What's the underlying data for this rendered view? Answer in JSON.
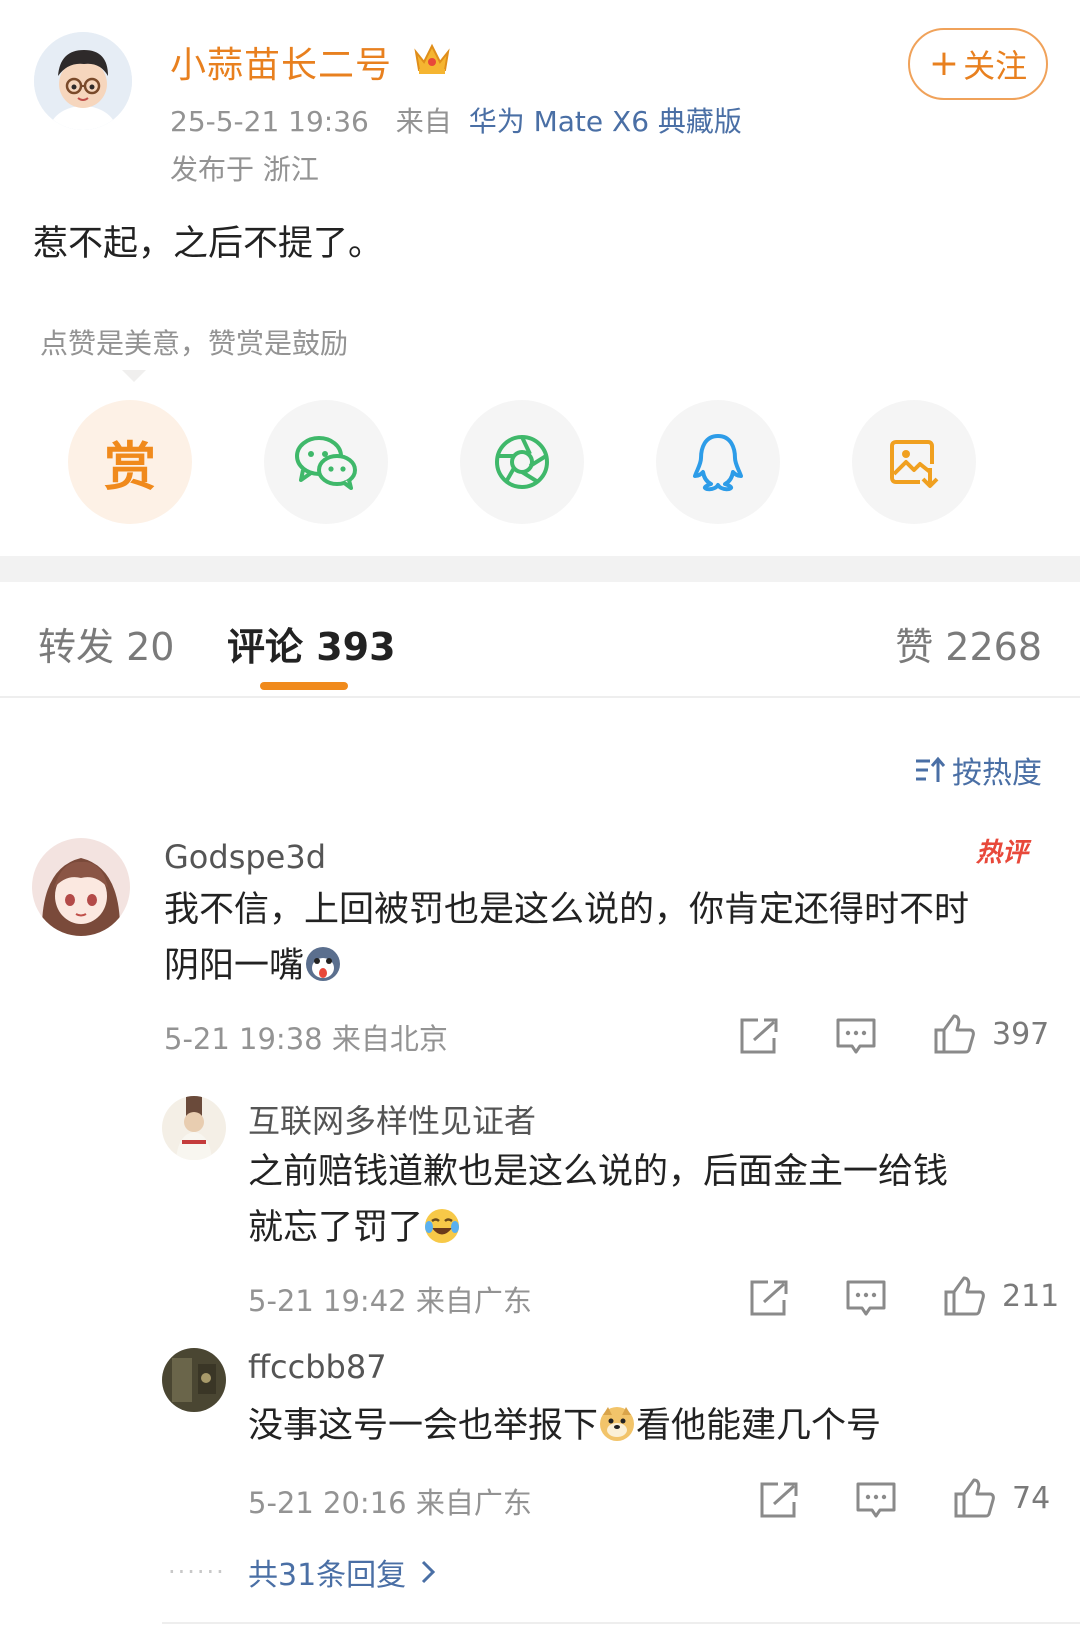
{
  "post": {
    "author": "小蒜苗长二号",
    "follow_label": "关注",
    "time": "25-5-21 19:36",
    "source_prefix": "来自",
    "device": "华为 Mate X6 典藏版",
    "location": "发布于 浙江",
    "text": "惹不起，之后不提了。"
  },
  "reward": {
    "tip": "点赞是美意，赞赏是鼓励",
    "reward_char": "赏"
  },
  "share_icons": [
    "reward-icon",
    "wechat-icon",
    "moments-icon",
    "qq-icon",
    "save-image-icon"
  ],
  "tabs": {
    "repost": "转发 20",
    "comments": "评论 393",
    "likes": "赞 2268"
  },
  "sort_label": "按热度",
  "comments": [
    {
      "name": "Godspe3d",
      "badge": "热评",
      "text_line1": "我不信，上回被罚也是这么说的，你肯定还得时不时",
      "text_line2": "阴阳一嘴",
      "time": "5-21 19:38  来自北京",
      "likes": "397"
    },
    {
      "name": "互联网多样性见证者",
      "text_line1": "之前赔钱道歉也是这么说的，后面金主一给钱",
      "text_line2": "就忘了罚了",
      "time": "5-21 19:42  来自广东",
      "likes": "211"
    },
    {
      "name": "ffccbb87",
      "text_part1": "没事这号一会也举报下",
      "text_part2": "看他能建几个号",
      "time": "5-21 20:16  来自广东",
      "likes": "74"
    }
  ],
  "more_replies": "共31条回复",
  "colors": {
    "accent_orange": "#e8801f",
    "link_blue": "#4a6fa5",
    "wechat_green": "#3fb86a",
    "qq_blue": "#2d9ce8",
    "hot_red": "#e8483a"
  }
}
